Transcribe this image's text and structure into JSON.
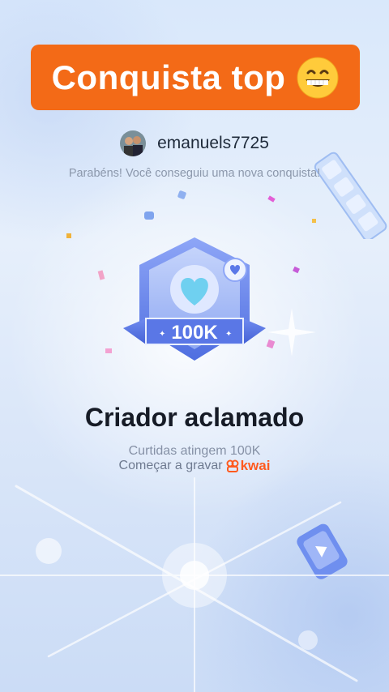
{
  "banner": {
    "text": "Conquista top",
    "emoji": "grinning-face-emoji"
  },
  "user": {
    "username": "emanuels7725",
    "avatar": "avatar"
  },
  "subtitle": "Parabéns! Você conseguiu uma nova conquista!",
  "badge": {
    "label": "100K",
    "icon": "heart-icon"
  },
  "achievement": {
    "title": "Criador aclamado",
    "description": "Curtidas atingem 100K",
    "record_label": "Começar a gravar",
    "brand": "kwai"
  },
  "colors": {
    "banner": "#f36a17",
    "brand": "#ff5a1f",
    "badge": "#5b78e8"
  }
}
